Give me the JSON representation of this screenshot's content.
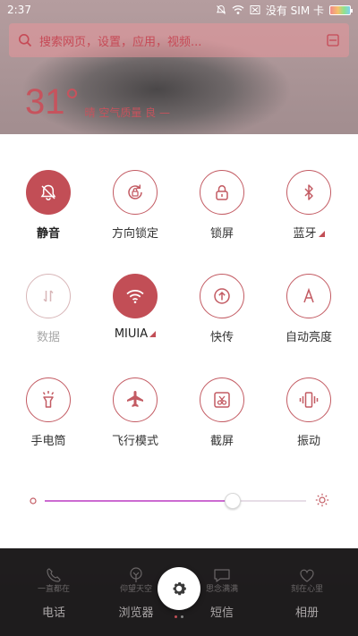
{
  "status_bar": {
    "time": "2:37",
    "no_sim": "没有 SIM 卡"
  },
  "search": {
    "placeholder": "搜索网页，设置，应用，视频..."
  },
  "weather": {
    "temperature": "31°",
    "condition": "晴",
    "aqi": "空气质量 良 —"
  },
  "quick_settings": [
    {
      "label": "静音",
      "icon": "bell-off-icon",
      "state": "active"
    },
    {
      "label": "方向锁定",
      "icon": "rotation-lock-icon",
      "state": "normal"
    },
    {
      "label": "锁屏",
      "icon": "lock-icon",
      "state": "normal"
    },
    {
      "label": "蓝牙",
      "icon": "bluetooth-icon",
      "state": "normal",
      "has_more": true
    },
    {
      "label": "数据",
      "icon": "mobile-data-icon",
      "state": "disabled"
    },
    {
      "label": "MIUIA",
      "icon": "wifi-icon",
      "state": "active",
      "has_more": true
    },
    {
      "label": "快传",
      "icon": "quick-transfer-icon",
      "state": "normal"
    },
    {
      "label": "自动亮度",
      "icon": "auto-brightness-icon",
      "state": "normal"
    },
    {
      "label": "手电筒",
      "icon": "flashlight-icon",
      "state": "normal"
    },
    {
      "label": "飞行模式",
      "icon": "airplane-icon",
      "state": "normal"
    },
    {
      "label": "截屏",
      "icon": "screenshot-icon",
      "state": "normal"
    },
    {
      "label": "振动",
      "icon": "vibrate-icon",
      "state": "normal"
    }
  ],
  "brightness": {
    "level": 0.72
  },
  "dock": [
    {
      "label": "电话",
      "sketch": "一直都在"
    },
    {
      "label": "浏览器",
      "sketch": "仰望天空"
    },
    {
      "label": "短信",
      "sketch": "思念满满"
    },
    {
      "label": "相册",
      "sketch": "刻在心里"
    }
  ],
  "colors": {
    "accent": "#c24e56",
    "slider": "#cc6bd1"
  }
}
